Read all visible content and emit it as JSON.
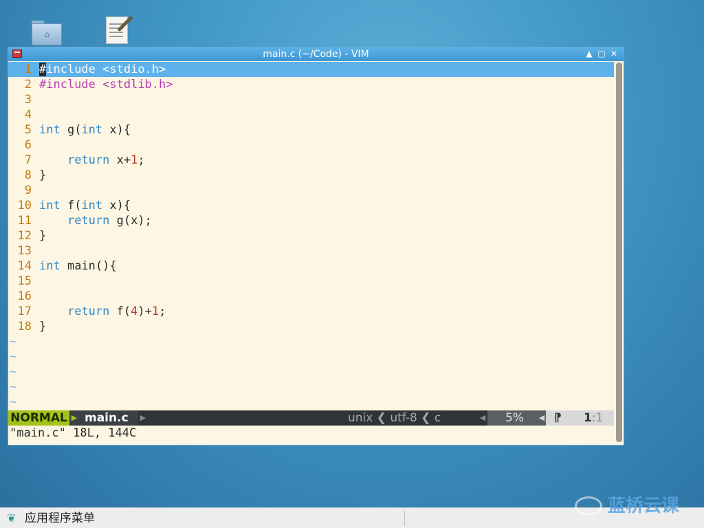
{
  "window": {
    "title": "main.c (~/Code) - VIM",
    "minimize": "▲",
    "maximize": "▢",
    "close": "✕"
  },
  "editor": {
    "lines": [
      {
        "num": "1",
        "code": "#include <stdio.h>"
      },
      {
        "num": "2",
        "code": "#include <stdlib.h>"
      },
      {
        "num": "3",
        "code": ""
      },
      {
        "num": "4",
        "code": ""
      },
      {
        "num": "5",
        "code": "int g(int x){"
      },
      {
        "num": "6",
        "code": ""
      },
      {
        "num": "7",
        "code": "    return x+1;"
      },
      {
        "num": "8",
        "code": "}"
      },
      {
        "num": "9",
        "code": ""
      },
      {
        "num": "10",
        "code": "int f(int x){"
      },
      {
        "num": "11",
        "code": "    return g(x);"
      },
      {
        "num": "12",
        "code": "}"
      },
      {
        "num": "13",
        "code": ""
      },
      {
        "num": "14",
        "code": "int main(){"
      },
      {
        "num": "15",
        "code": ""
      },
      {
        "num": "16",
        "code": ""
      },
      {
        "num": "17",
        "code": "    return f(4)+1;"
      },
      {
        "num": "18",
        "code": "}"
      }
    ],
    "tilde": "~",
    "tilde_count": 5
  },
  "statusline": {
    "mode": "NORMAL",
    "filename": "main.c",
    "fileinfo": "unix ❮ utf-8 ❮ c",
    "percent": "5%",
    "position_line": "1",
    "position_col": ":1"
  },
  "message": "\"main.c\" 18L, 144C",
  "taskbar": {
    "start_label": "应用程序菜单"
  },
  "watermark": {
    "text": "蓝桥云课"
  },
  "colors": {
    "keyword": "#2e86c8",
    "preprocessor": "#b33fb3",
    "number": "#c0392b",
    "line_number": "#c07a13",
    "mode_bg": "#a5c21a",
    "editor_bg": "#fdf6e3",
    "cursorline_bg": "#5eb1ea"
  }
}
